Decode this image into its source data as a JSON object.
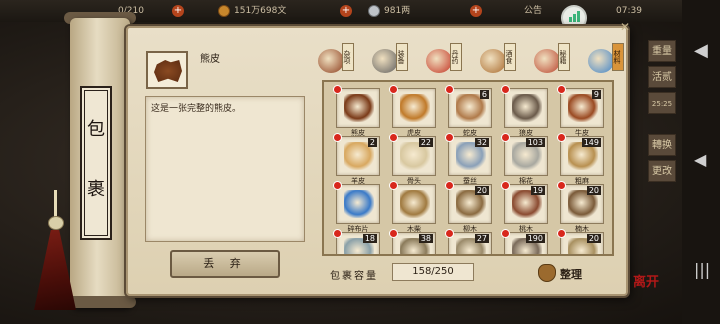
{
  "status": {
    "counter": "0/210",
    "currency_copper": "151万698文",
    "currency_silver": "981两",
    "notice": "公告",
    "time": "07:39"
  },
  "right_tabs": [
    "重量",
    "活贰",
    "25:25",
    "轉换",
    "更改"
  ],
  "scroll_label": [
    "包",
    "裹"
  ],
  "selected_item": {
    "name": "熊皮",
    "description": "这是一张完整的熊皮。"
  },
  "discard_label": "丢 弃",
  "categories": [
    {
      "label": "杂项",
      "icon": "jar-icon",
      "color": "#8a3a1a",
      "active": false
    },
    {
      "label": "装备",
      "icon": "armor-icon",
      "color": "#5a5a5a",
      "active": false
    },
    {
      "label": "丹药",
      "icon": "pill-icon",
      "color": "#c23020",
      "active": false
    },
    {
      "label": "酒食",
      "icon": "wine-icon",
      "color": "#a8682a",
      "active": false
    },
    {
      "label": "秘籍",
      "icon": "book-icon",
      "color": "#b8402a",
      "active": false
    },
    {
      "label": "材料",
      "icon": "crystal-icon",
      "color": "#3a80c8",
      "active": true
    }
  ],
  "items": [
    {
      "label": "熊皮",
      "count": "",
      "dot": true,
      "color": "#7a3a18",
      "icon": "bear-hide-icon"
    },
    {
      "label": "虎皮",
      "count": "",
      "dot": true,
      "color": "#c07a2a",
      "icon": "tiger-hide-icon"
    },
    {
      "label": "蛇皮",
      "count": "6",
      "dot": true,
      "color": "#b07a4a",
      "icon": "snake-skin-icon"
    },
    {
      "label": "狼皮",
      "count": "",
      "dot": true,
      "color": "#6a5a4a",
      "icon": "wolf-hide-icon"
    },
    {
      "label": "牛皮",
      "count": "9",
      "dot": true,
      "color": "#9a4a22",
      "icon": "cow-hide-icon"
    },
    {
      "label": "羊皮",
      "count": "2",
      "dot": true,
      "color": "#d8a860",
      "icon": "sheep-hide-icon"
    },
    {
      "label": "骨头",
      "count": "22",
      "dot": true,
      "color": "#d8c8a0",
      "icon": "bone-icon"
    },
    {
      "label": "蚕丝",
      "count": "32",
      "dot": true,
      "color": "#8aa0b8",
      "icon": "silk-icon"
    },
    {
      "label": "棉花",
      "count": "103",
      "dot": true,
      "color": "#a8a8a0",
      "icon": "cotton-icon"
    },
    {
      "label": "粗麻",
      "count": "149",
      "dot": true,
      "color": "#b89050",
      "icon": "hemp-icon"
    },
    {
      "label": "碎布片",
      "count": "",
      "dot": true,
      "color": "#3a7ac8",
      "icon": "cloth-scrap-icon"
    },
    {
      "label": "木柴",
      "count": "",
      "dot": true,
      "color": "#a07a40",
      "icon": "firewood-icon"
    },
    {
      "label": "柳木",
      "count": "20",
      "dot": true,
      "color": "#8a6a40",
      "icon": "willow-wood-icon"
    },
    {
      "label": "桃木",
      "count": "19",
      "dot": true,
      "color": "#8a4a30",
      "icon": "peach-wood-icon"
    },
    {
      "label": "楠木",
      "count": "20",
      "dot": true,
      "color": "#7a5a38",
      "icon": "nanmu-wood-icon"
    },
    {
      "label": "",
      "count": "18",
      "dot": true,
      "color": "#8aa0a8",
      "icon": "material-icon"
    },
    {
      "label": "",
      "count": "38",
      "dot": true,
      "color": "#8a7a5a",
      "icon": "material-icon"
    },
    {
      "label": "",
      "count": "27",
      "dot": true,
      "color": "#9a8a6a",
      "icon": "material-icon"
    },
    {
      "label": "",
      "count": "190",
      "dot": true,
      "color": "#7a6a5a",
      "icon": "material-icon"
    },
    {
      "label": "",
      "count": "20",
      "dot": true,
      "color": "#a89060",
      "icon": "material-icon"
    }
  ],
  "capacity_label": "包裹容量",
  "capacity_value": "158/250",
  "sort_label": "整理",
  "logo_text": "离开"
}
